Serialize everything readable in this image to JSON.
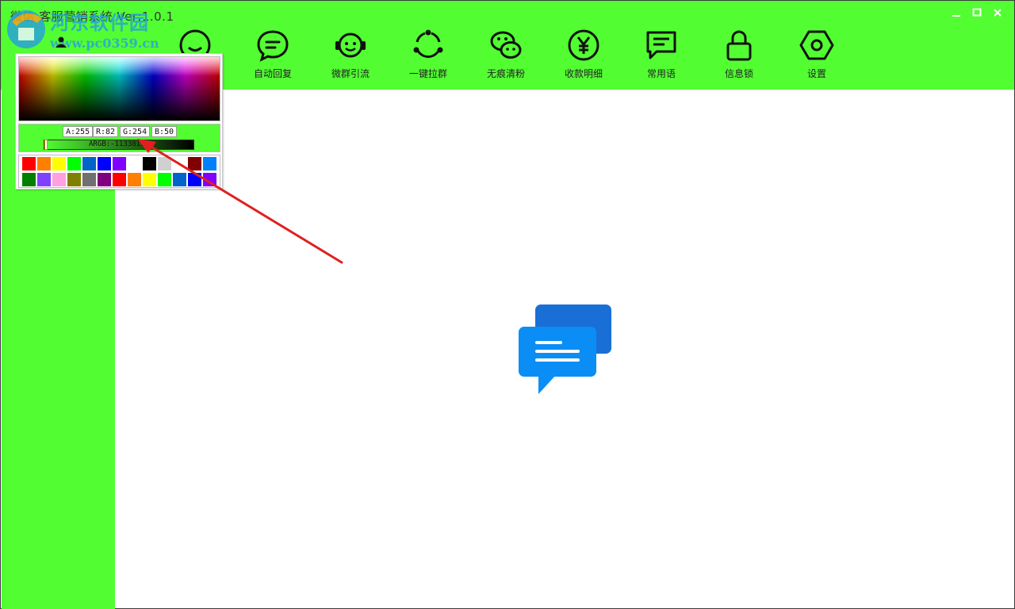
{
  "window": {
    "title": "微信 客服营销系统 Ver:1.0.1"
  },
  "watermark": {
    "line1": "河东软件园",
    "line2": "www.pc0359.cn"
  },
  "nav": {
    "items": [
      {
        "label": "",
        "icon": "smile-icon"
      },
      {
        "label": "自动回复",
        "icon": "chat-bubble-icon"
      },
      {
        "label": "微群引流",
        "icon": "headset-face-icon"
      },
      {
        "label": "一键拉群",
        "icon": "group-circle-icon"
      },
      {
        "label": "无痕清粉",
        "icon": "wechat-icon"
      },
      {
        "label": "收款明细",
        "icon": "yen-icon"
      },
      {
        "label": "常用语",
        "icon": "message-lines-icon"
      },
      {
        "label": "信息锁",
        "icon": "lock-icon"
      },
      {
        "label": "设置",
        "icon": "hexagon-settings-icon"
      }
    ]
  },
  "picker": {
    "a": "A:255",
    "r": "R:82",
    "g": "G:254",
    "b": "B:50",
    "argb": "ARGB:-11338190",
    "selected_color": "#52fe32",
    "swatches": [
      "#ff0000",
      "#ff8000",
      "#ffff00",
      "#00ff00",
      "#0064c8",
      "#0000ff",
      "#8000ff",
      "#ffffff",
      "#000000",
      "#d0d0d0",
      "#ffffff",
      "#800000",
      "#0080ff",
      "#008000",
      "#8040ff",
      "#ffa0e0",
      "#808000",
      "#707070",
      "#800080",
      "#ff0000",
      "#ff8000",
      "#ffff00",
      "#00ff00",
      "#0064c8",
      "#0000ff",
      "#8000ff"
    ]
  },
  "colors": {
    "accent": "#52fe32",
    "chat_blue_front": "#0a8ef5",
    "chat_blue_back": "#1a6fd6",
    "arrow_red": "#e02020"
  }
}
